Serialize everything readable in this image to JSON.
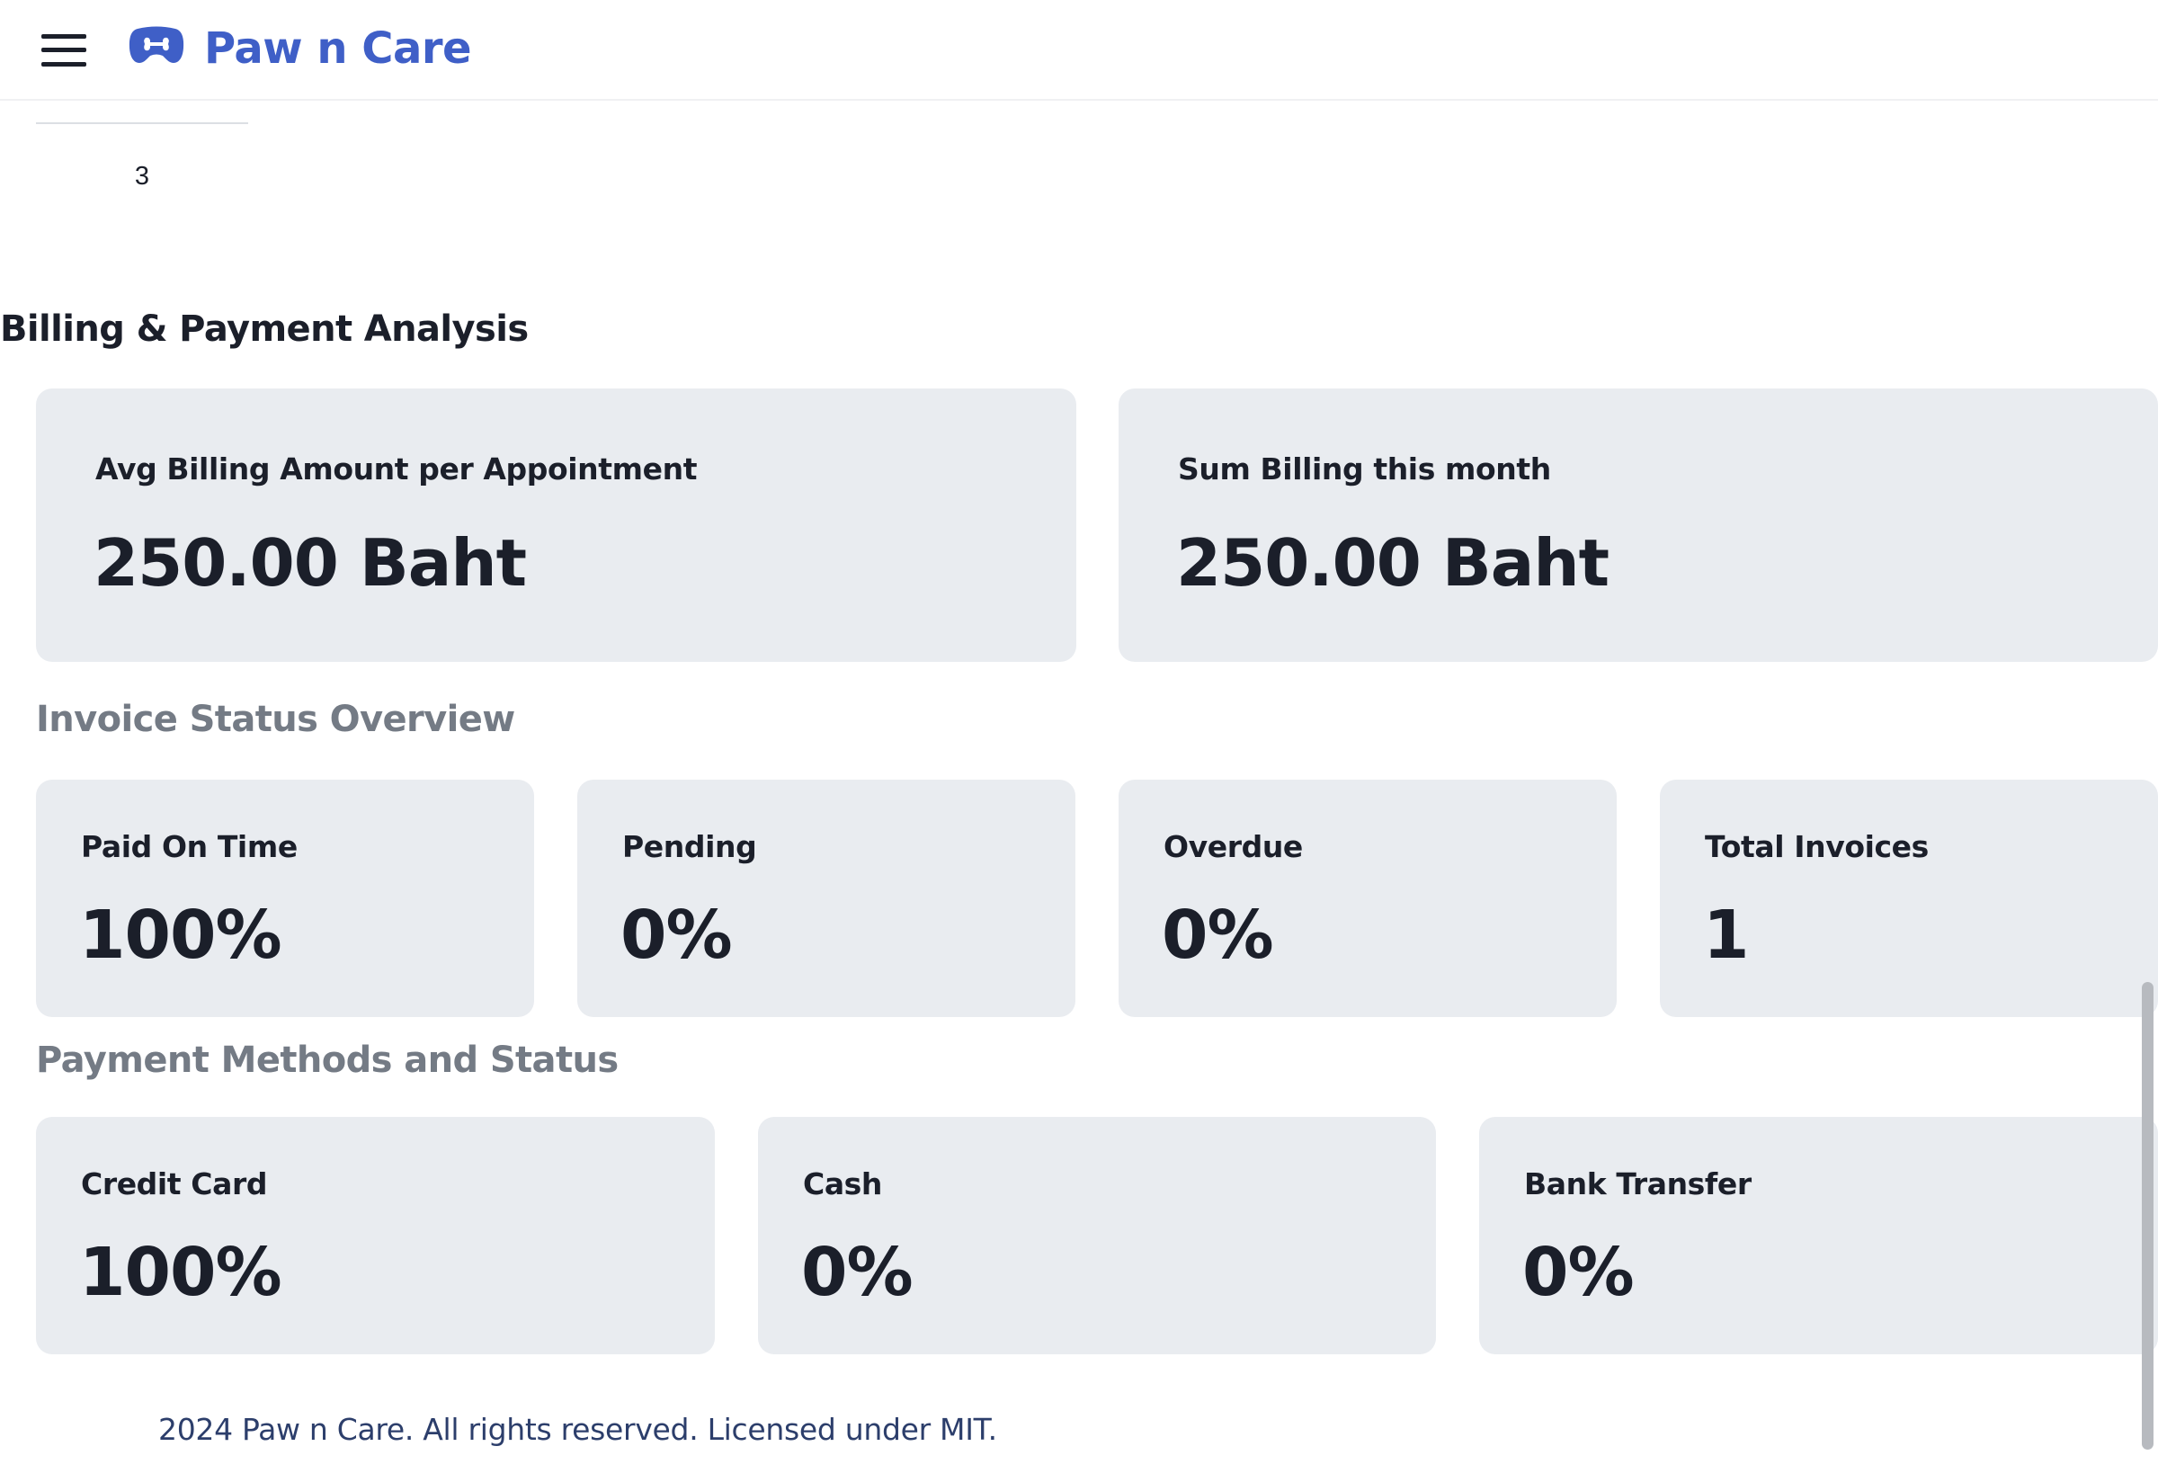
{
  "header": {
    "brand": "Paw n Care",
    "menu_icon": "hamburger-menu-icon",
    "logo_icon": "pet-logo-icon",
    "brand_color": "#3f5fc7"
  },
  "pagination": {
    "current_page": "3"
  },
  "billing": {
    "title": "Billing & Payment Analysis",
    "avg_label": "Avg Billing Amount per Appointment",
    "avg_value": "250.00 Baht",
    "sum_label": "Sum Billing this month",
    "sum_value": "250.00 Baht"
  },
  "invoice_status": {
    "title": "Invoice Status Overview",
    "items": [
      {
        "label": "Paid On Time",
        "value": "100%"
      },
      {
        "label": "Pending",
        "value": "0%"
      },
      {
        "label": "Overdue",
        "value": "0%"
      },
      {
        "label": "Total Invoices",
        "value": "1"
      }
    ]
  },
  "payment_methods": {
    "title": "Payment Methods and Status",
    "items": [
      {
        "label": "Credit Card",
        "value": "100%"
      },
      {
        "label": "Cash",
        "value": "0%"
      },
      {
        "label": "Bank Transfer",
        "value": "0%"
      }
    ]
  },
  "footer": {
    "text": "2024 Paw n Care. All rights reserved. Licensed under MIT."
  },
  "colors": {
    "card_background": "#e9ecf0",
    "subtitle_gray": "#747b85",
    "footer_text": "#2c3e6b"
  }
}
